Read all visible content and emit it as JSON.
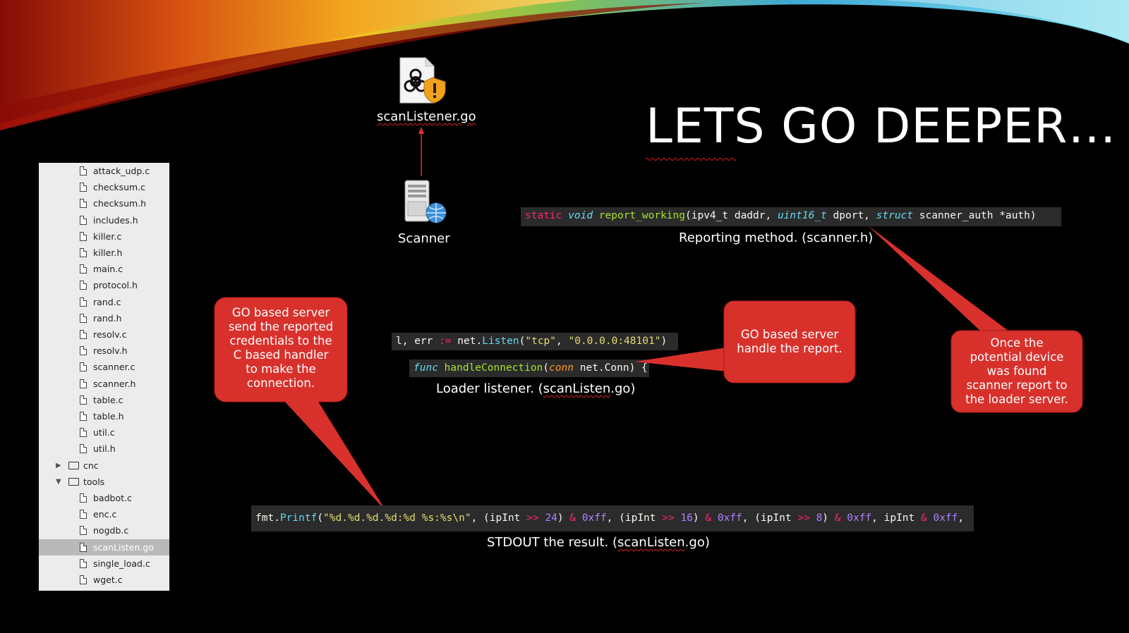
{
  "slide": {
    "title": "LETS GO DEEPER…"
  },
  "colors": {
    "background": "#000000",
    "bubble_red": "#d8312c",
    "code_bg": "#2b2b2b",
    "tree_bg": "#ececec",
    "tree_selected": "#b9b9b9"
  },
  "file_tree": {
    "items": [
      {
        "label": "attack_udp.c",
        "type": "file"
      },
      {
        "label": "checksum.c",
        "type": "file"
      },
      {
        "label": "checksum.h",
        "type": "file"
      },
      {
        "label": "includes.h",
        "type": "file"
      },
      {
        "label": "killer.c",
        "type": "file"
      },
      {
        "label": "killer.h",
        "type": "file"
      },
      {
        "label": "main.c",
        "type": "file"
      },
      {
        "label": "protocol.h",
        "type": "file"
      },
      {
        "label": "rand.c",
        "type": "file"
      },
      {
        "label": "rand.h",
        "type": "file"
      },
      {
        "label": "resolv.c",
        "type": "file"
      },
      {
        "label": "resolv.h",
        "type": "file"
      },
      {
        "label": "scanner.c",
        "type": "file"
      },
      {
        "label": "scanner.h",
        "type": "file"
      },
      {
        "label": "table.c",
        "type": "file"
      },
      {
        "label": "table.h",
        "type": "file"
      },
      {
        "label": "util.c",
        "type": "file"
      },
      {
        "label": "util.h",
        "type": "file"
      },
      {
        "label": "cnc",
        "type": "folder-collapsed"
      },
      {
        "label": "tools",
        "type": "folder-expanded"
      },
      {
        "label": "badbot.c",
        "type": "file"
      },
      {
        "label": "enc.c",
        "type": "file"
      },
      {
        "label": "nogdb.c",
        "type": "file"
      },
      {
        "label": "scanListen.go",
        "type": "file",
        "selected": true
      },
      {
        "label": "single_load.c",
        "type": "file"
      },
      {
        "label": "wget.c",
        "type": "file"
      }
    ]
  },
  "icons": {
    "scanlistener": {
      "label": "scanListener.go",
      "icon": "biohazard-file-icon"
    },
    "scanner": {
      "label": "Scanner",
      "icon": "server-globe-icon"
    }
  },
  "code": {
    "report": {
      "t1": "static",
      "t2": " ",
      "t3": "void",
      "t4": " ",
      "t5": "report_working",
      "t6": "(ipv4_t daddr, ",
      "t7": "uint16_t",
      "t8": " dport, ",
      "t9": "struct",
      "t10": " scanner_auth *auth)"
    },
    "listen": {
      "t1": "l, err ",
      "t2": ":=",
      "t3": " net.",
      "t4": "Listen",
      "t5": "(",
      "t6": "\"tcp\"",
      "t7": ", ",
      "t8": "\"0.0.0.0:48101\"",
      "t9": ")"
    },
    "handle": {
      "t1": "func",
      "t2": " ",
      "t3": "handleConnection",
      "t4": "(",
      "t5": "conn",
      "t6": " net.Conn) {"
    },
    "printf": {
      "t1": "fmt.",
      "t2": "Printf",
      "t3": "(",
      "t4": "\"%d.%d.%d.%d:%d %s:%s\\n\"",
      "t5": ", (ipInt ",
      "t6": ">>",
      "t7": " ",
      "t8": "24",
      "t9": ") ",
      "t10": "&",
      "t11": " ",
      "t12": "0xff",
      "t13": ", (ipInt ",
      "t14": ">>",
      "t15": " ",
      "t16": "16",
      "t17": ") ",
      "t18": "&",
      "t19": " ",
      "t20": "0xff",
      "t21": ", (ipInt ",
      "t22": ">>",
      "t23": " ",
      "t24": "8",
      "t25": ") ",
      "t26": "&",
      "t27": " ",
      "t28": "0xff",
      "t29": ", ipInt ",
      "t30": "&",
      "t31": " ",
      "t32": "0xff",
      "t33": ","
    }
  },
  "captions": {
    "report": "Reporting method. (scanner.h)",
    "loader_prefix": "Loader listener. (",
    "loader_file": "scanListen",
    "loader_suffix": ".go)",
    "stdout_prefix": "STDOUT the result. (",
    "stdout_file": "scanListen",
    "stdout_suffix": ".go)"
  },
  "bubbles": {
    "left": [
      "GO based server",
      "send the reported",
      "credentials to the",
      "C based handler",
      "to make the",
      "connection."
    ],
    "middle": [
      "GO based server",
      "handle the report."
    ],
    "right": [
      "Once the",
      "potential device",
      "was found",
      "scanner report to",
      "the loader server."
    ]
  }
}
